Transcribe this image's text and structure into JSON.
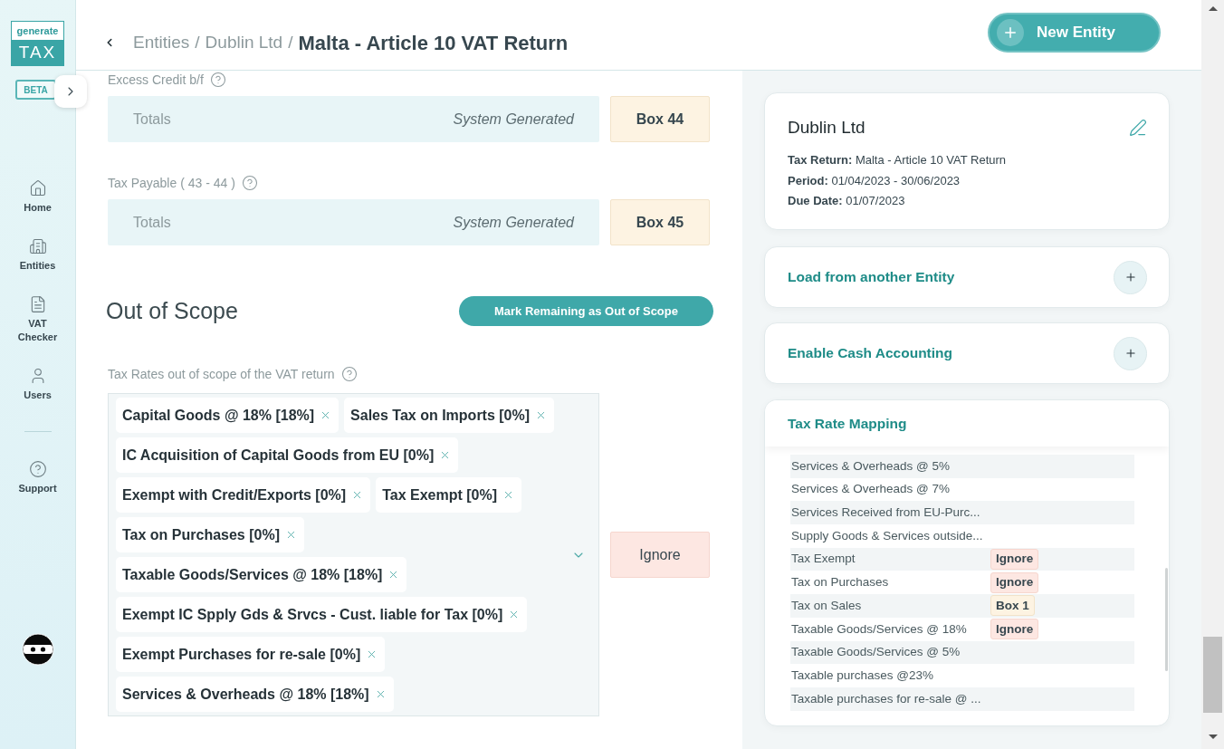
{
  "sidebar": {
    "logo": {
      "top": "generate",
      "bottom": "TAX"
    },
    "badge": "BETA",
    "nav": [
      {
        "kind": "home",
        "label": "Home"
      },
      {
        "kind": "entities",
        "label": "Entities"
      },
      {
        "kind": "checker",
        "label": "VAT Checker"
      },
      {
        "kind": "users",
        "label": "Users"
      }
    ],
    "footer_nav": [
      {
        "kind": "support",
        "label": "Support"
      }
    ]
  },
  "header": {
    "breadcrumb": [
      {
        "label": "Entities"
      },
      {
        "label": "Dublin Ltd"
      }
    ],
    "separator": "/",
    "title": "Malta - Article 10 VAT Return",
    "action_button": "New Entity"
  },
  "fields": [
    {
      "label": "Excess Credit b/f",
      "value": "Totals",
      "note": "System Generated",
      "box": {
        "kind": "box",
        "text": "Box 44"
      }
    },
    {
      "label": "Tax Payable ( 43 - 44 )",
      "value": "Totals",
      "note": "System Generated",
      "box": {
        "kind": "box",
        "text": "Box 45"
      }
    }
  ],
  "out_of_scope": {
    "title": "Out of Scope",
    "button": "Mark Remaining as Out of Scope",
    "field_label": "Tax Rates out of scope of the VAT return",
    "chips": [
      "Capital Goods @ 18% [18%]",
      "Sales Tax on Imports [0%]",
      "IC Acquisition of Capital Goods from EU [0%]",
      "Exempt with Credit/Exports [0%]",
      "Tax Exempt [0%]",
      "Tax on Purchases [0%]",
      "Taxable Goods/Services @ 18% [18%]",
      "Exempt IC Spply Gds & Srvcs - Cust. liable for Tax [0%]",
      "Exempt Purchases for re-sale [0%]",
      "Services & Overheads @ 18% [18%]"
    ],
    "box": {
      "kind": "ignore",
      "text": "Ignore"
    }
  },
  "entity_card": {
    "name": "Dublin Ltd",
    "details": [
      "**Tax Return:** Malta - Article 10 VAT Return",
      "**Period:** 01/04/2023 - 30/06/2023",
      "**Due Date:** 01/07/2023"
    ]
  },
  "sections": [
    {
      "title": "Load from another Entity",
      "expanded": false
    },
    {
      "title": "Enable Cash Accounting",
      "expanded": false
    }
  ],
  "tax_rate_mapping": {
    "title": "Tax Rate Mapping",
    "rows": [
      {
        "label": "Services & Overheads @ 5%"
      },
      {
        "label": "Services & Overheads @ 7%"
      },
      {
        "label": "Services Received from EU-Purc..."
      },
      {
        "label": "Supply Goods & Services outside..."
      },
      {
        "label": "Tax Exempt",
        "tag": {
          "kind": "ignore",
          "text": "Ignore"
        }
      },
      {
        "label": "Tax on Purchases",
        "tag": {
          "kind": "ignore",
          "text": "Ignore"
        }
      },
      {
        "label": "Tax on Sales",
        "tag": {
          "kind": "box",
          "text": "Box 1"
        }
      },
      {
        "label": "Taxable Goods/Services @ 18%",
        "tag": {
          "kind": "ignore",
          "text": "Ignore"
        }
      },
      {
        "label": "Taxable Goods/Services @ 5%"
      },
      {
        "label": "Taxable purchases @23%"
      },
      {
        "label": "Taxable purchases for re-sale @ ..."
      }
    ]
  }
}
